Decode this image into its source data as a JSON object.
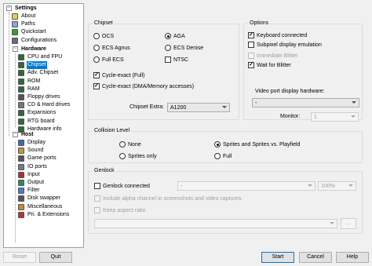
{
  "tree": {
    "root_label": "Settings",
    "top_items": [
      {
        "label": "About",
        "icon": "about-icon",
        "color": "#f2c94c"
      },
      {
        "label": "Paths",
        "icon": "paths-icon",
        "color": "#8aa7d6"
      },
      {
        "label": "Quickstart",
        "icon": "quickstart-icon",
        "color": "#33a02c"
      },
      {
        "label": "Configurations",
        "icon": "configurations-icon",
        "color": "#6b6b6b"
      }
    ],
    "hardware_label": "Hardware",
    "hardware_items": [
      {
        "label": "CPU and FPU",
        "icon": "cpu-icon",
        "color": "#2f6b2f"
      },
      {
        "label": "Chipset",
        "icon": "chipset-icon",
        "color": "#2f6b2f"
      },
      {
        "label": "Adv. Chipset",
        "icon": "adv-chipset-icon",
        "color": "#2f6b2f"
      },
      {
        "label": "ROM",
        "icon": "rom-icon",
        "color": "#2f6b2f"
      },
      {
        "label": "RAM",
        "icon": "ram-icon",
        "color": "#2f6b2f"
      },
      {
        "label": "Floppy drives",
        "icon": "floppy-icon",
        "color": "#555555"
      },
      {
        "label": "CD & Hard drives",
        "icon": "harddrive-icon",
        "color": "#777777"
      },
      {
        "label": "Expansions",
        "icon": "expansions-icon",
        "color": "#2f6b2f"
      },
      {
        "label": "RTG board",
        "icon": "rtg-board-icon",
        "color": "#2f6b2f"
      },
      {
        "label": "Hardware info",
        "icon": "hardware-info-icon",
        "color": "#2f6b2f"
      }
    ],
    "host_label": "Host",
    "host_items": [
      {
        "label": "Display",
        "icon": "display-icon",
        "color": "#3a6ea5"
      },
      {
        "label": "Sound",
        "icon": "sound-icon",
        "color": "#c2992e"
      },
      {
        "label": "Game ports",
        "icon": "game-ports-icon",
        "color": "#555555"
      },
      {
        "label": "IO ports",
        "icon": "io-ports-icon",
        "color": "#7a7a7a"
      },
      {
        "label": "Input",
        "icon": "input-icon",
        "color": "#b03030"
      },
      {
        "label": "Output",
        "icon": "output-icon",
        "color": "#2e8b57"
      },
      {
        "label": "Filter",
        "icon": "filter-icon",
        "color": "#4a7fc1"
      },
      {
        "label": "Disk swapper",
        "icon": "disk-swapper-icon",
        "color": "#555555"
      },
      {
        "label": "Miscellaneous",
        "icon": "miscellaneous-icon",
        "color": "#d08a2a"
      },
      {
        "label": "Pri. & Extensions",
        "icon": "priority-icon",
        "color": "#c03030"
      }
    ]
  },
  "chipset": {
    "title": "Chipset",
    "ocs": "OCS",
    "aga": "AGA",
    "ecs_agnus": "ECS Agnus",
    "ecs_denise": "ECS Denise",
    "full_ecs": "Full ECS",
    "ntsc": "NTSC",
    "cycle_exact_full": "Cycle-exact (Full)",
    "cycle_exact_dma": "Cycle-exact (DMA/Memory accesses)",
    "extra_label": "Chipset Extra:",
    "extra_value": "A1200"
  },
  "options": {
    "title": "Options",
    "keyboard_connected": "Keyboard connected",
    "subpixel": "Subpixel display emulation",
    "immediate_blitter": "Immediate Blitter",
    "wait_for_blitter": "Wait for Blitter",
    "video_port_label": "Video port display hardware:",
    "video_port_value": "-",
    "monitor_label": "Monitor:",
    "monitor_value": "1"
  },
  "collision": {
    "title": "Collision Level",
    "none": "None",
    "sprites_only": "Sprites only",
    "sprites_playfield": "Sprites and Sprites vs. Playfield",
    "full": "Full"
  },
  "genlock": {
    "title": "Genlock",
    "connected": "Genlock connected",
    "mode_value": "-",
    "opacity_value": "100%",
    "include_alpha": "Include alpha channel in screenshots and video captures.",
    "keep_aspect": "Keep aspect ratio",
    "file_value": "",
    "browse_label": "..."
  },
  "buttons": {
    "reset": "Reset",
    "quit": "Quit",
    "start": "Start",
    "cancel": "Cancel",
    "help": "Help"
  }
}
